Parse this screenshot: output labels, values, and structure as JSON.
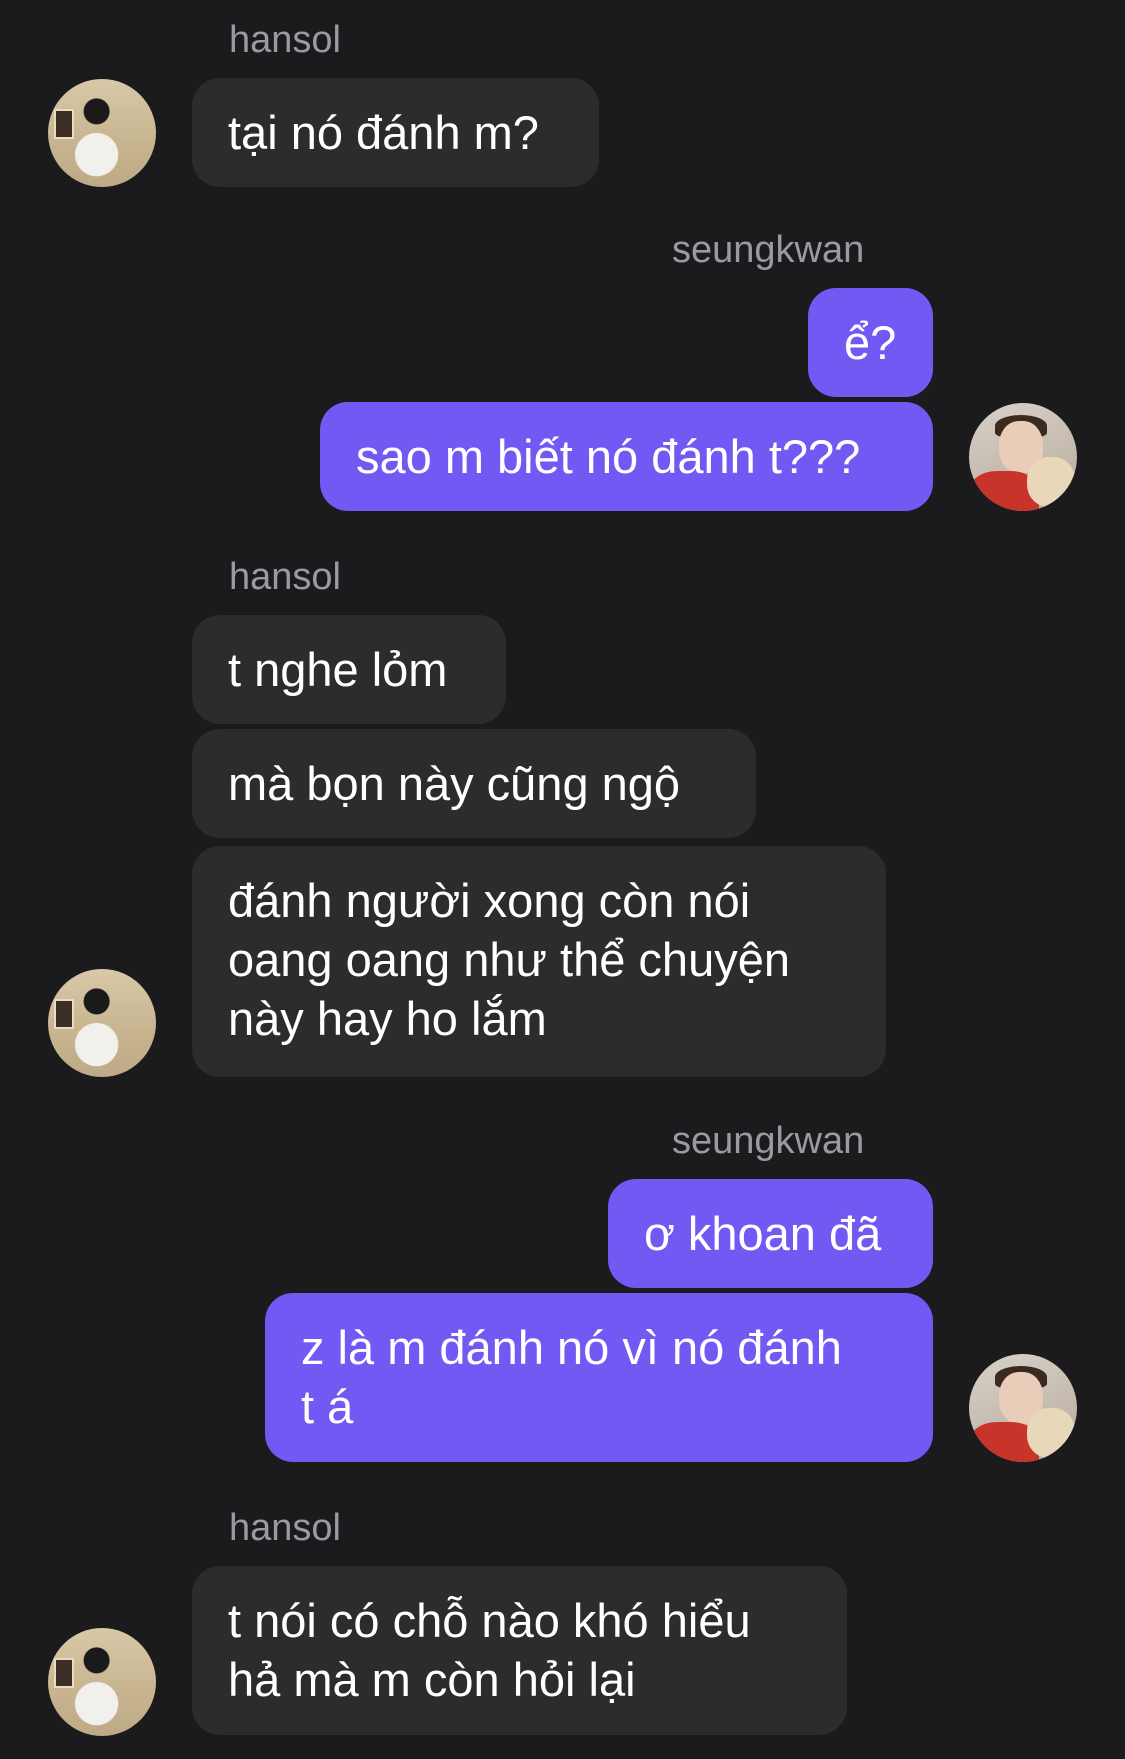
{
  "participants": {
    "hansol": "hansol",
    "seungkwan": "seungkwan"
  },
  "colors": {
    "background": "#1b1b1d",
    "incoming_bubble": "#2c2c2f",
    "outgoing_bubble": "#7359f3",
    "sender_label": "#9a9a9f"
  },
  "messages": [
    {
      "text": "tại nó đánh m?"
    },
    {
      "text": "ể?"
    },
    {
      "text": "sao m biết nó đánh t???"
    },
    {
      "text": "t nghe lỏm"
    },
    {
      "text": "mà bọn này cũng ngộ"
    },
    {
      "text": "đánh người xong còn nói\noang oang như thể chuyện\nnày hay ho lắm"
    },
    {
      "text": "ơ khoan đã"
    },
    {
      "text": "z là m đánh nó vì nó đánh\nt á"
    },
    {
      "text": "t nói có chỗ nào khó hiểu\nhả mà m còn hỏi lại"
    }
  ]
}
